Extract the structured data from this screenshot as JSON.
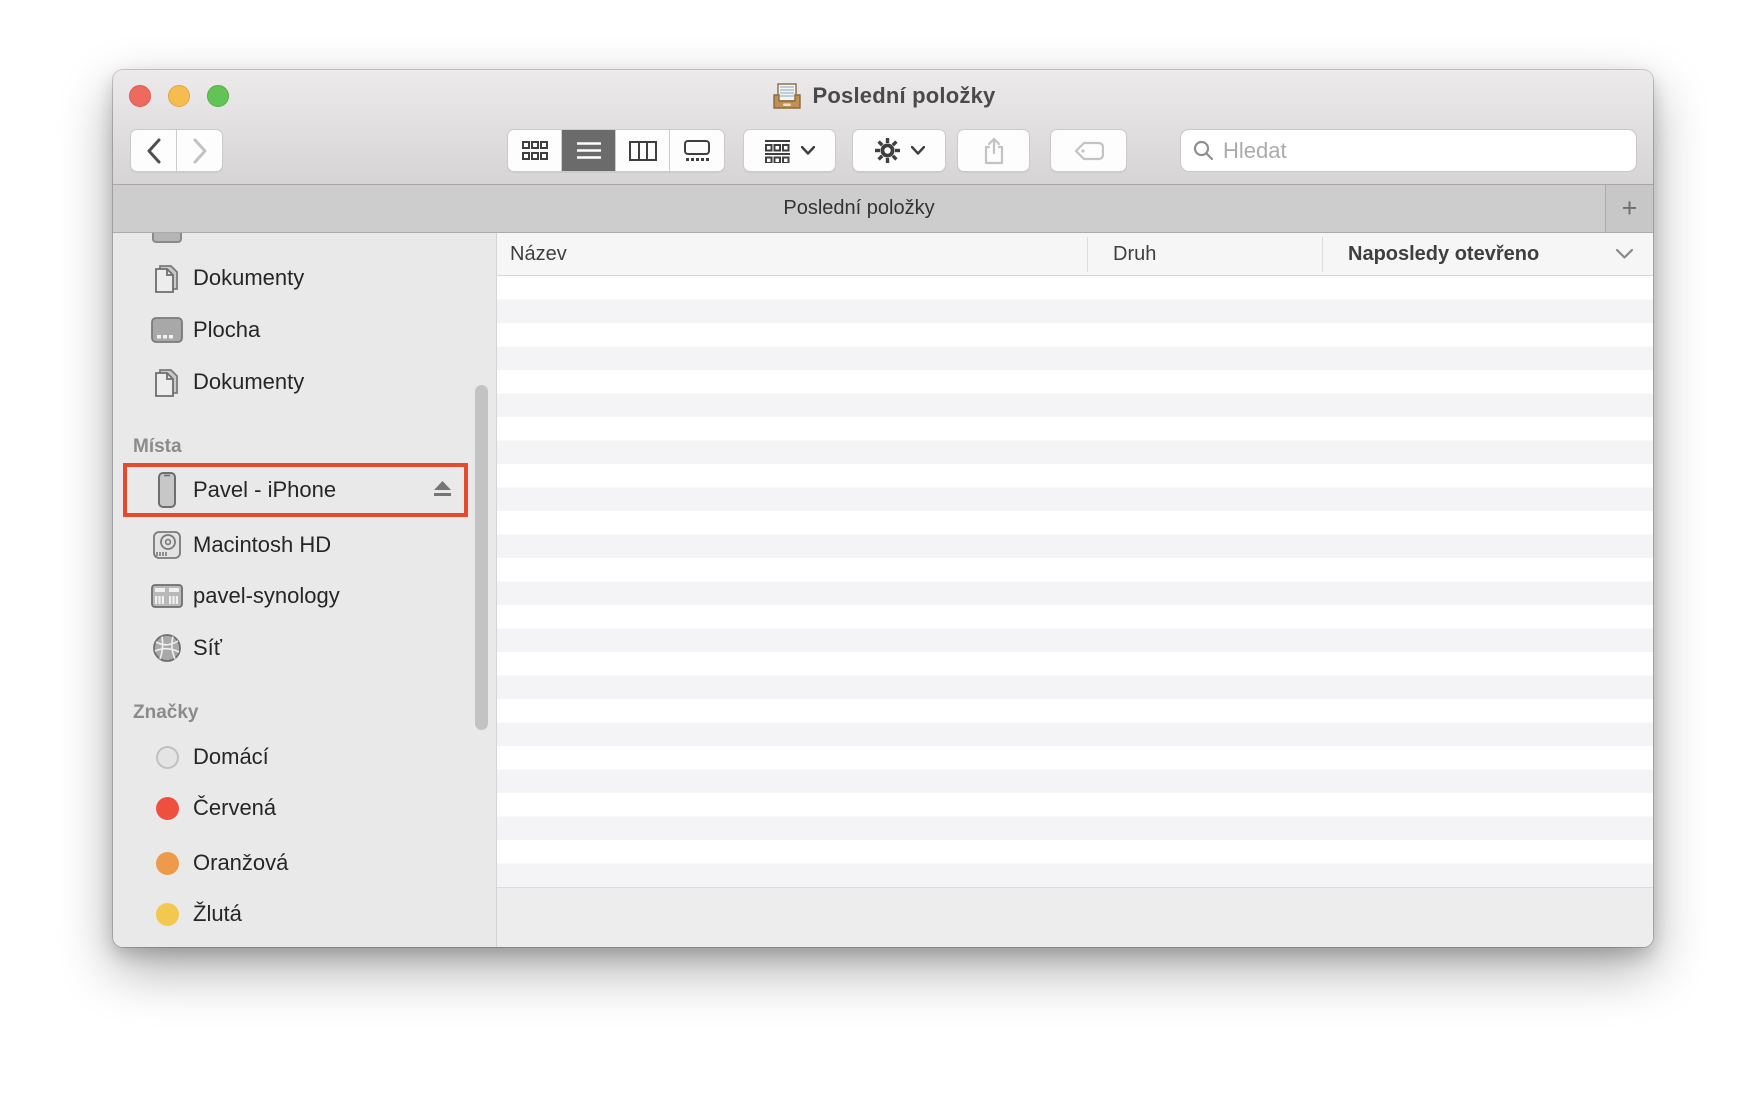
{
  "window": {
    "title": "Poslední položky"
  },
  "toolbar": {
    "search_placeholder": "Hledat"
  },
  "tabbar": {
    "tab_label": "Poslední položky",
    "add_tab_label": "+"
  },
  "columns": {
    "name": "Název",
    "kind": "Druh",
    "last_opened": "Naposledy otevřeno"
  },
  "sidebar": {
    "favorites": [
      {
        "label": "Dokumenty"
      },
      {
        "label": "Plocha"
      },
      {
        "label": "Dokumenty"
      }
    ],
    "places": {
      "label": "Místa",
      "items": [
        {
          "label": "Pavel - iPhone",
          "highlighted": true,
          "ejectable": true
        },
        {
          "label": "Macintosh HD"
        },
        {
          "label": "pavel-synology"
        },
        {
          "label": "Síť"
        }
      ]
    },
    "tags": {
      "label": "Značky",
      "items": [
        {
          "label": "Domácí",
          "color": "transparent",
          "border": "#c0c0c0"
        },
        {
          "label": "Červená",
          "color": "#ee4f3e",
          "border": "#e04434"
        },
        {
          "label": "Oranžová",
          "color": "#ed9a4a",
          "border": "#e08c3c"
        },
        {
          "label": "Žlutá",
          "color": "#f2c94e",
          "border": "#e5ba40"
        }
      ]
    }
  },
  "colors": {
    "highlight_rect": "#e5492f",
    "selected_segment": "#6b6b6b",
    "traffic_red": "#ee6a5e",
    "traffic_yellow": "#f5bd4f",
    "traffic_green": "#61c454"
  }
}
